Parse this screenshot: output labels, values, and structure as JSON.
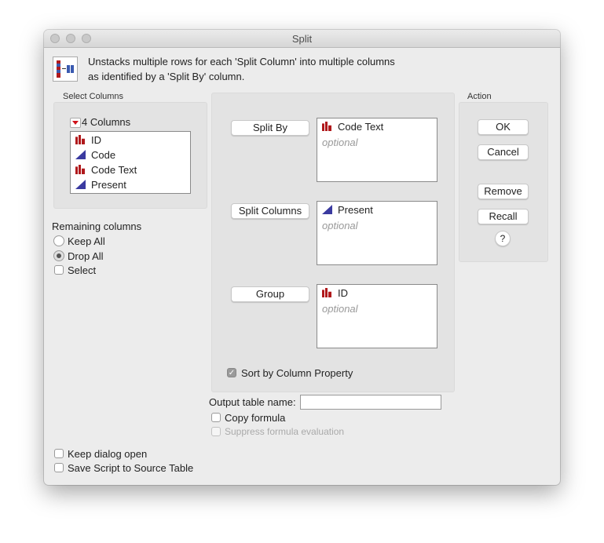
{
  "window": {
    "title": "Split"
  },
  "description": {
    "line1": "Unstacks multiple rows for each 'Split Column' into multiple columns",
    "line2": "as identified by a 'Split By' column."
  },
  "select_columns": {
    "label": "Select Columns",
    "count_label": "4 Columns",
    "items": [
      {
        "label": "ID",
        "type": "nominal"
      },
      {
        "label": "Code",
        "type": "continuous"
      },
      {
        "label": "Code Text",
        "type": "nominal"
      },
      {
        "label": "Present",
        "type": "continuous"
      }
    ]
  },
  "remaining": {
    "label": "Remaining columns",
    "options": [
      {
        "label": "Keep All",
        "selected": false
      },
      {
        "label": "Drop All",
        "selected": true
      }
    ],
    "select_label": "Select"
  },
  "roles": [
    {
      "button": "Split By",
      "value": "Code Text",
      "type": "nominal",
      "placeholder": "optional"
    },
    {
      "button": "Split Columns",
      "value": "Present",
      "type": "continuous",
      "placeholder": "optional"
    },
    {
      "button": "Group",
      "value": "ID",
      "type": "nominal",
      "placeholder": "optional"
    }
  ],
  "sort_by_property": {
    "label": "Sort by Column Property",
    "checked": true
  },
  "action": {
    "label": "Action",
    "ok": "OK",
    "cancel": "Cancel",
    "remove": "Remove",
    "recall": "Recall",
    "help": "?"
  },
  "output": {
    "label": "Output table name:",
    "value": ""
  },
  "copy_formula": {
    "label": "Copy formula",
    "checked": false
  },
  "suppress_formula": {
    "label": "Suppress formula evaluation",
    "checked": false,
    "disabled": true
  },
  "keep_open": {
    "label": "Keep dialog open",
    "checked": false
  },
  "save_script": {
    "label": "Save Script to Source Table",
    "checked": false
  },
  "colors": {
    "nominal": "#b0191c",
    "continuous": "#3a3aa0"
  }
}
